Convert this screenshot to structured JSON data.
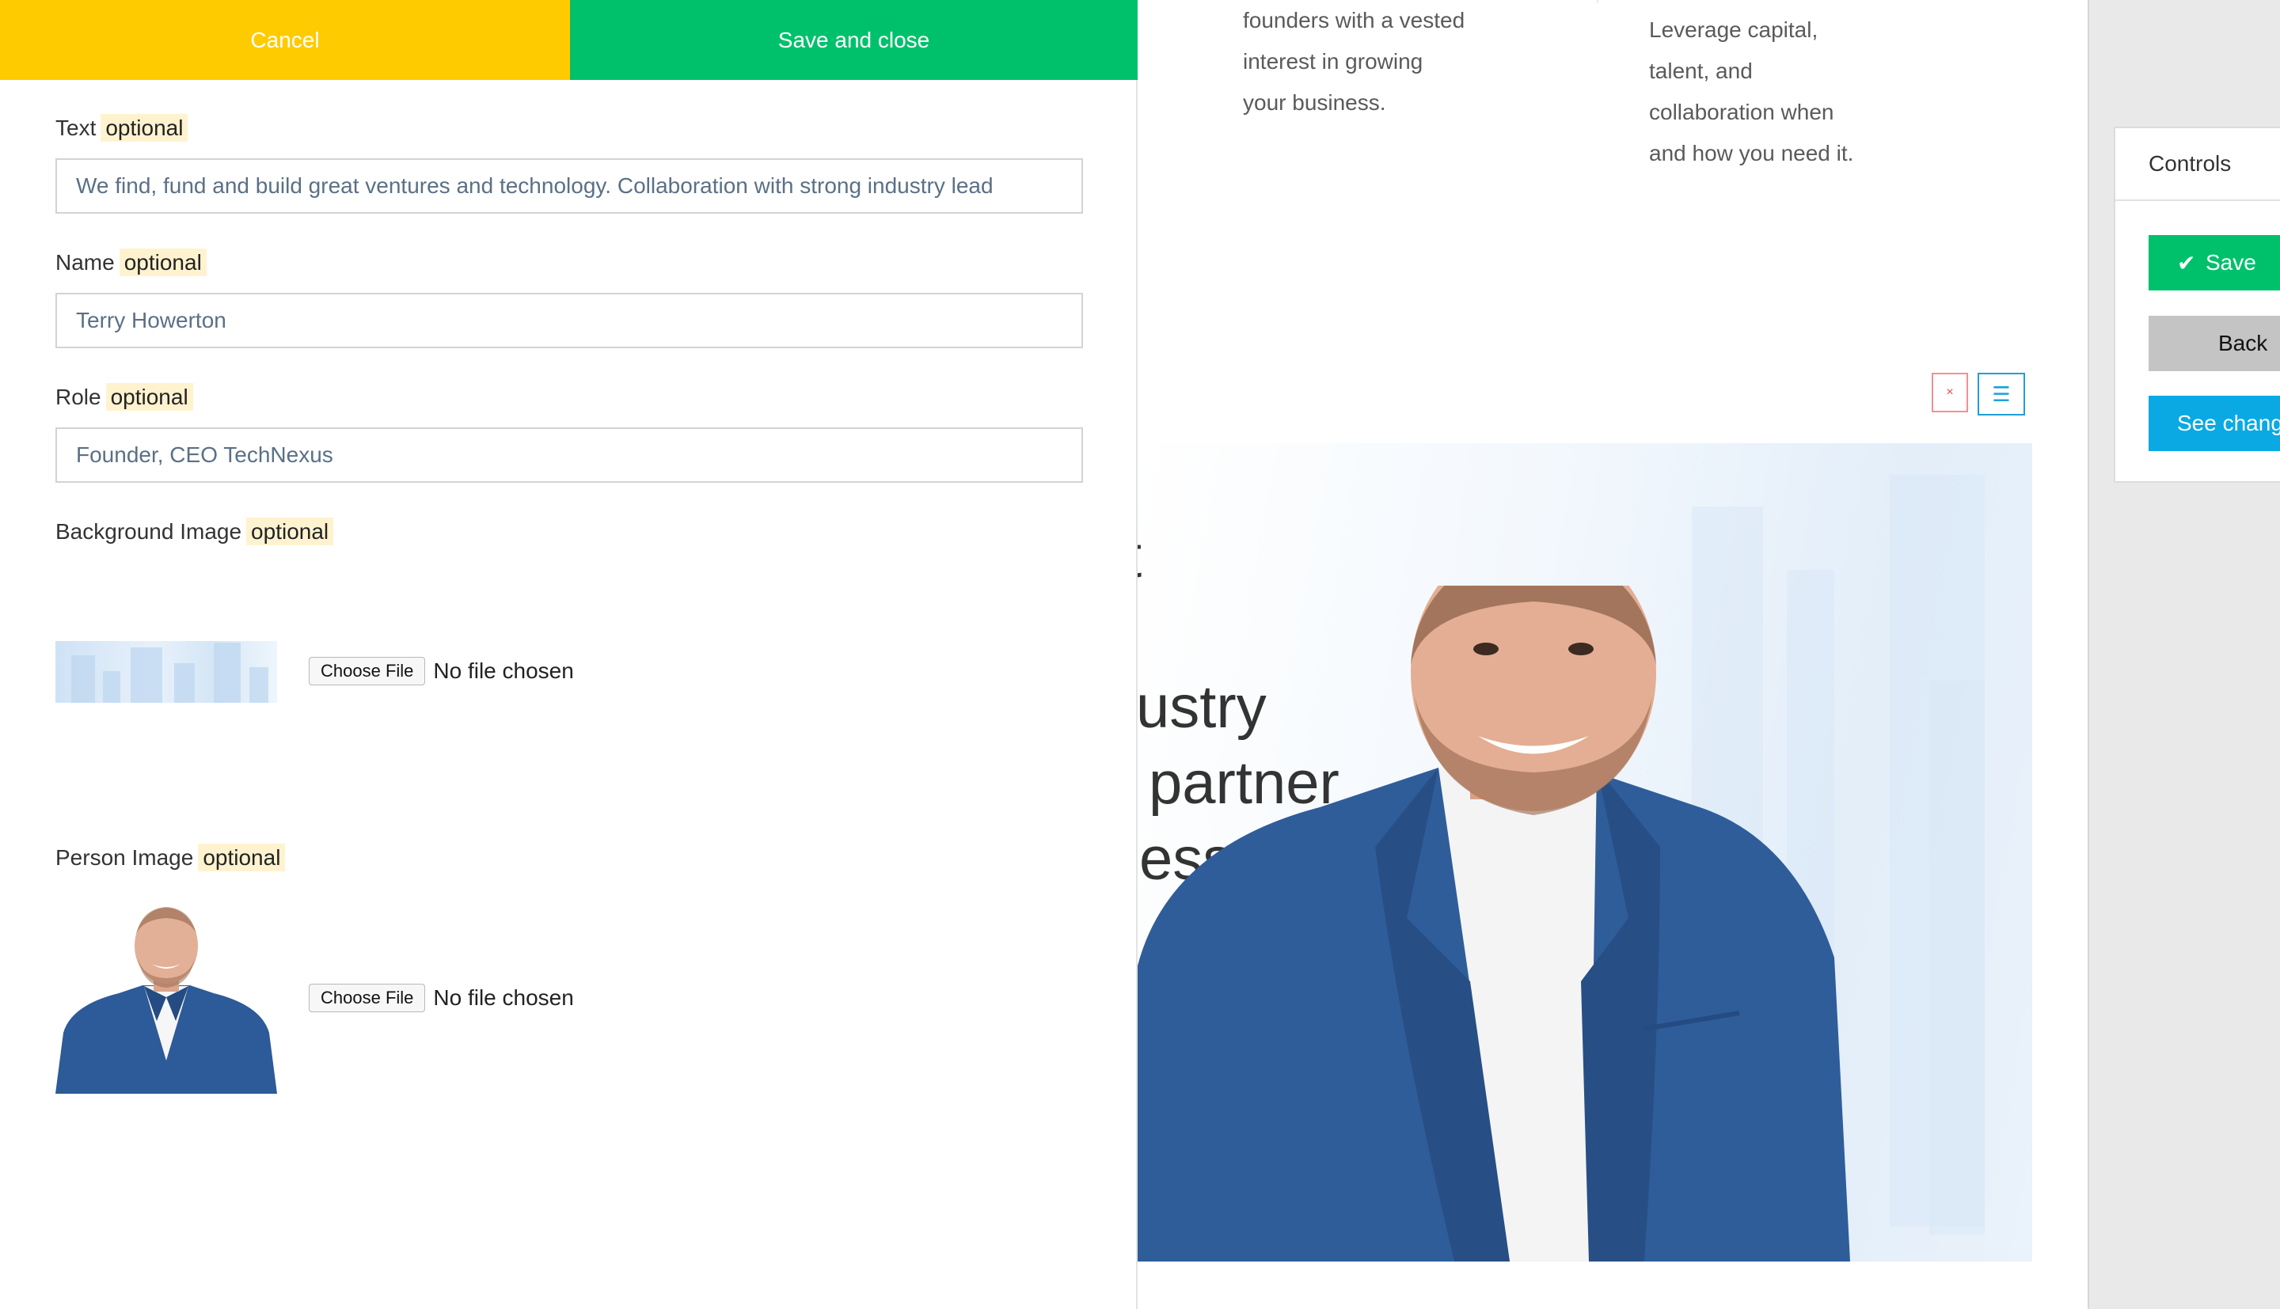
{
  "action_bar": {
    "cancel_label": "Cancel",
    "save_close_label": "Save and close"
  },
  "form": {
    "optional_tag": "optional",
    "text": {
      "label": "Text",
      "value": "We find, fund and build great ventures and technology. Collaboration with strong industry lead"
    },
    "name": {
      "label": "Name",
      "value": "Terry Howerton"
    },
    "role": {
      "label": "Role",
      "value": "Founder, CEO TechNexus"
    },
    "background_image": {
      "label": "Background Image",
      "choose_label": "Choose File",
      "status": "No file chosen"
    },
    "person_image": {
      "label": "Person Image",
      "choose_label": "Choose File",
      "status": "No file chosen"
    }
  },
  "preview": {
    "col_left_lines": [
      "founders with a vested",
      "interest in growing",
      "your business."
    ],
    "col_right_lines": [
      "Leverage capital,",
      "talent, and",
      "collaboration when",
      "and how you need it."
    ],
    "remove_icon": "×",
    "move_icon": "☰",
    "quote_fragments": [
      "t",
      "ustry",
      "partner",
      "ess so"
    ]
  },
  "controls": {
    "title": "Controls",
    "save_label": "Save",
    "back_label": "Back",
    "see_changes_label": "See chang"
  },
  "colors": {
    "cancel": "#fecb00",
    "save": "#00c16b",
    "info": "#0aa9e4",
    "optional_highlight": "#fff3cf"
  }
}
